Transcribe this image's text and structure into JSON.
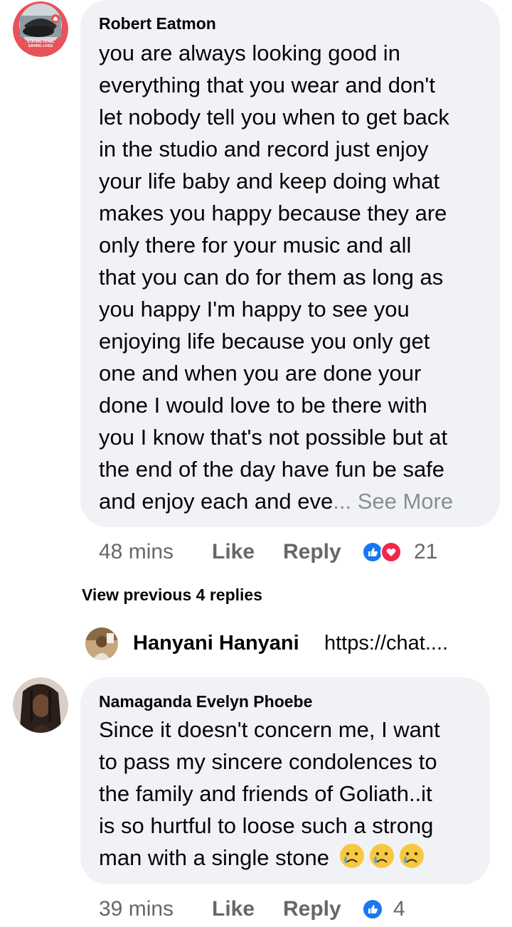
{
  "comments": [
    {
      "author": "Robert Eatmon",
      "avatar_badge_line1": "STAYING HOME",
      "avatar_badge_line2": "SAVING LIVES",
      "lines": [
        "you are always looking good in",
        "everything that you wear and don't",
        "let nobody tell you when to get back",
        "in the studio and record just enjoy",
        "your life baby and keep doing what",
        "makes you happy because they are",
        "only there for your music and all",
        "that you can do for them as long as",
        "you happy I'm happy to see you",
        "enjoying life because you only get",
        "one and when you are done your",
        "done I would love to be there with",
        "you I know that's not possible but at",
        "the end of the day have fun be safe"
      ],
      "last_line": "and enjoy each and eve",
      "ellipsis": "...",
      "see_more": "See More",
      "time": "48 mins",
      "like_label": "Like",
      "reply_label": "Reply",
      "reactions": [
        "like-icon",
        "love-icon"
      ],
      "reaction_count": "21"
    },
    {
      "author": "Namaganda Evelyn Phoebe",
      "lines": [
        "Since it doesn't concern me, I want",
        "to pass my sincere condolences to",
        "the family and friends of Goliath..it",
        "is so hurtful to loose such a strong"
      ],
      "last_line": "man with a single stone",
      "emojis": [
        "crying-face-emoji",
        "crying-face-emoji",
        "crying-face-emoji"
      ],
      "time": "39 mins",
      "like_label": "Like",
      "reply_label": "Reply",
      "reactions": [
        "like-icon"
      ],
      "reaction_count": "4"
    }
  ],
  "view_previous": "View previous 4 replies",
  "reply_preview": {
    "name": "Hanyani Hanyani",
    "snippet": "https://chat....",
    "avatar_icon": "user-avatar"
  },
  "colors": {
    "bubble": "#f0f2f5",
    "meta": "#65676b",
    "like_blue": "#1877f2",
    "love_red": "#f02849",
    "avatar_red_ring": "#e8525a"
  }
}
